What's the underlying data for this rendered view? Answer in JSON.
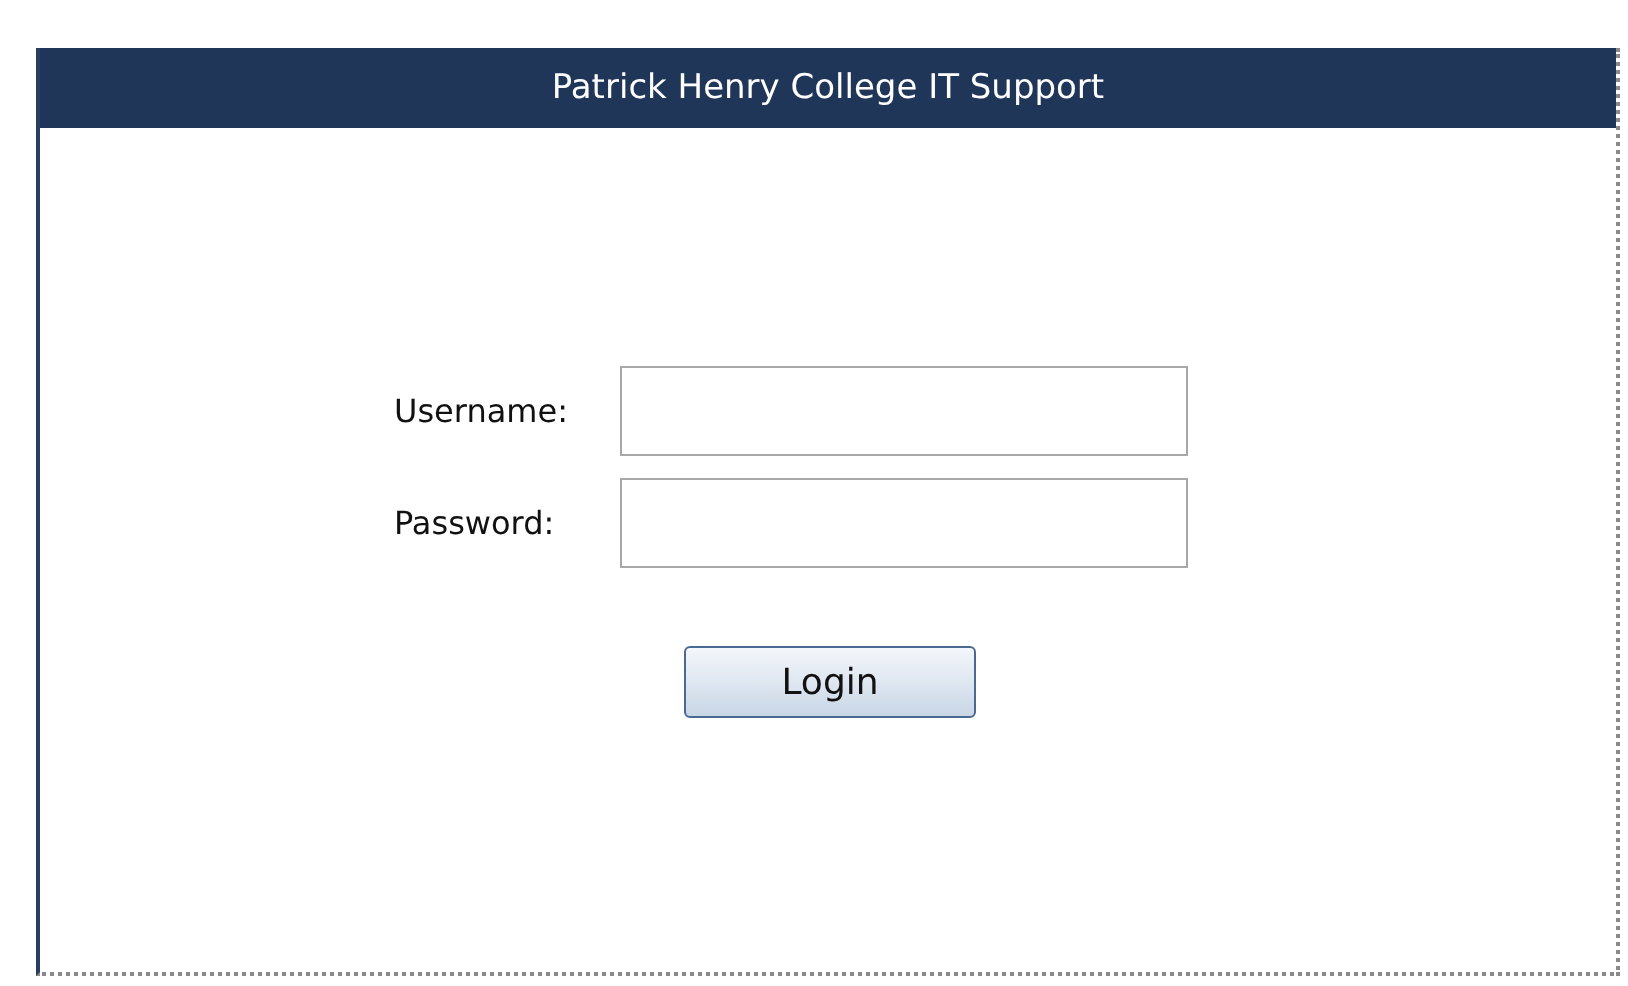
{
  "header": {
    "title": "Patrick Henry College IT Support"
  },
  "fields": [
    {
      "label": "Username:"
    },
    {
      "label": "Password:"
    }
  ],
  "button": {
    "label": "Login"
  }
}
